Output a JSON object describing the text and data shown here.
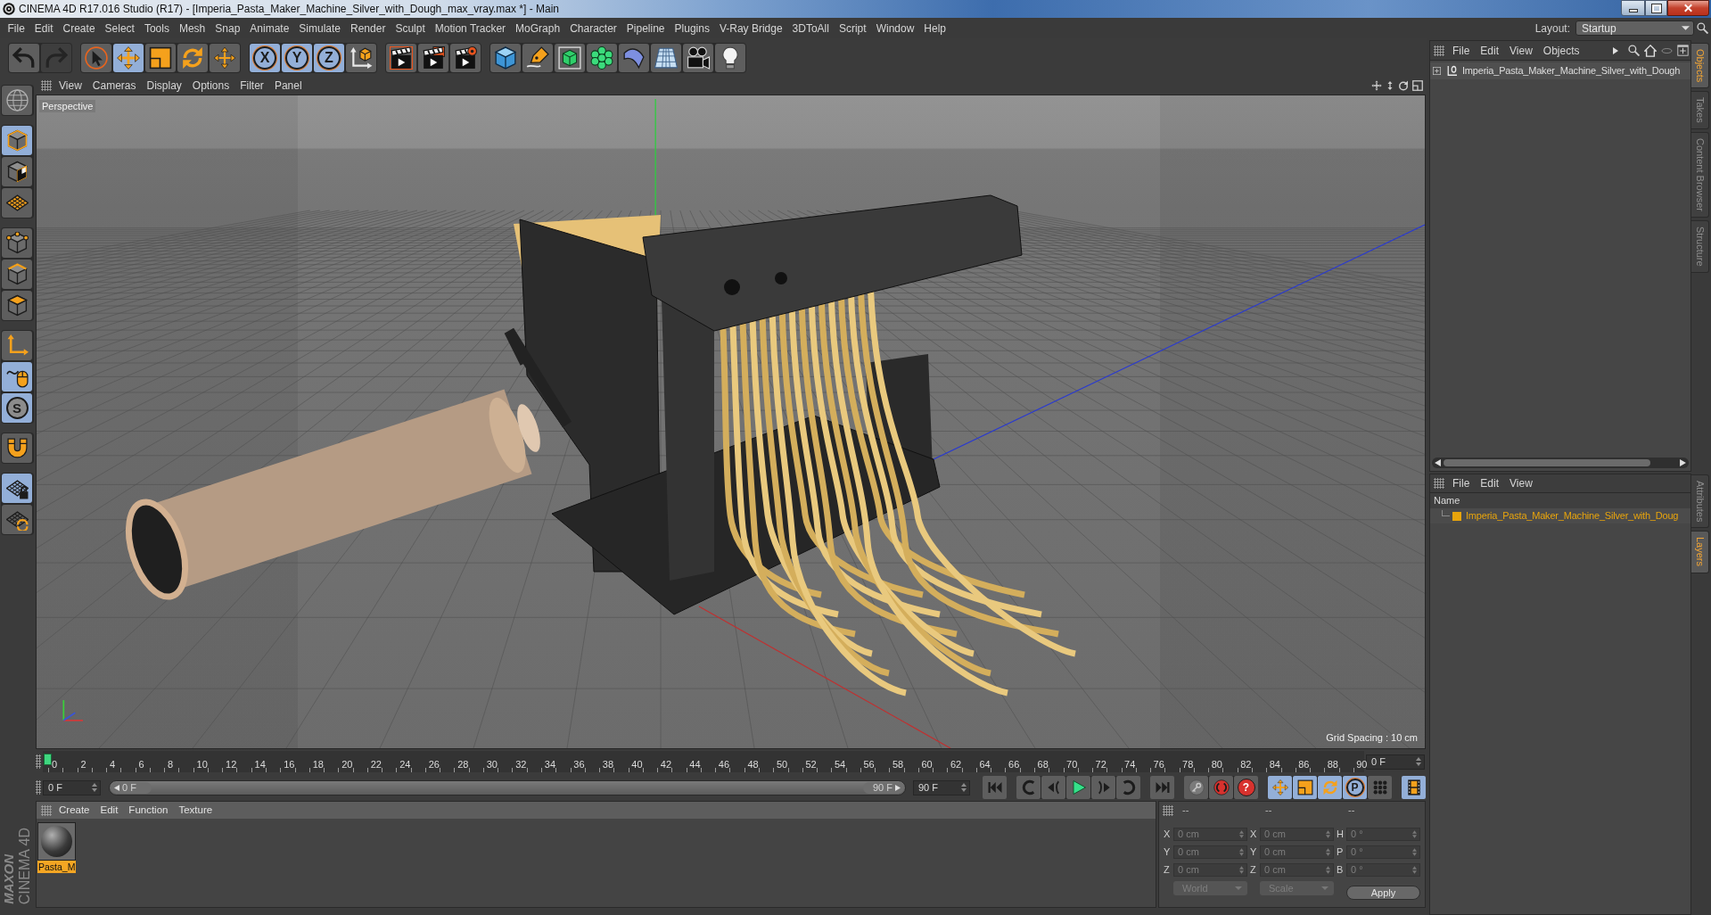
{
  "window": {
    "title": "CINEMA 4D R17.016 Studio (R17) - [Imperia_Pasta_Maker_Machine_Silver_with_Dough_max_vray.max *] - Main",
    "controls": [
      {
        "kind": "minimize"
      },
      {
        "kind": "maximize"
      },
      {
        "kind": "close"
      }
    ]
  },
  "menu_bar": [
    "File",
    "Edit",
    "Create",
    "Select",
    "Tools",
    "Mesh",
    "Snap",
    "Animate",
    "Simulate",
    "Render",
    "Sculpt",
    "Motion Tracker",
    "MoGraph",
    "Character",
    "Pipeline",
    "Plugins",
    "V-Ray Bridge",
    "3DToAll",
    "Script",
    "Window",
    "Help"
  ],
  "layout": {
    "label": "Layout:",
    "value": "Startup"
  },
  "toolbar": [
    [
      {
        "kind": "undo",
        "active": false,
        "disabled": false
      },
      {
        "kind": "redo",
        "active": false,
        "disabled": true
      }
    ],
    [
      {
        "kind": "select",
        "active": false,
        "disabled": false
      },
      {
        "kind": "move",
        "active": true,
        "disabled": false
      },
      {
        "kind": "scale",
        "active": false,
        "disabled": false
      },
      {
        "kind": "rotate",
        "active": false,
        "disabled": false
      },
      {
        "kind": "transform",
        "active": false,
        "disabled": false
      }
    ],
    [
      {
        "kind": "x-axis",
        "label": "X",
        "active": true,
        "disabled": false
      },
      {
        "kind": "y-axis",
        "label": "Y",
        "active": true,
        "disabled": false
      },
      {
        "kind": "z-axis",
        "label": "Z",
        "active": true,
        "disabled": false
      },
      {
        "kind": "coordinate-system",
        "active": false,
        "disabled": false
      }
    ],
    [
      {
        "kind": "render-view",
        "active": false,
        "disabled": false
      },
      {
        "kind": "render-picture",
        "active": false,
        "disabled": false
      },
      {
        "kind": "render-settings",
        "active": false,
        "disabled": false
      }
    ],
    [
      {
        "kind": "cube",
        "active": false,
        "disabled": false
      },
      {
        "kind": "pen",
        "active": false,
        "disabled": false
      },
      {
        "kind": "subdivision",
        "active": false,
        "disabled": false
      },
      {
        "kind": "cloner",
        "active": false,
        "disabled": false
      },
      {
        "kind": "deformer",
        "active": false,
        "disabled": false
      },
      {
        "kind": "floor",
        "active": false,
        "disabled": false
      },
      {
        "kind": "camera",
        "active": false,
        "disabled": false
      },
      {
        "kind": "light",
        "active": false,
        "disabled": false
      }
    ]
  ],
  "left_tools": [
    [
      {
        "kind": "globe",
        "active": false
      }
    ],
    [
      {
        "kind": "model",
        "active": true
      },
      {
        "kind": "texture",
        "active": false
      },
      {
        "kind": "workplane",
        "active": false
      }
    ],
    [
      {
        "kind": "points",
        "active": false
      },
      {
        "kind": "edges",
        "active": false
      },
      {
        "kind": "polygons",
        "active": false
      }
    ],
    [
      {
        "kind": "axis",
        "active": false
      },
      {
        "kind": "tweak",
        "active": true
      },
      {
        "kind": "solo",
        "label": "S",
        "active": true
      }
    ],
    [
      {
        "kind": "snap",
        "active": false
      }
    ],
    [
      {
        "kind": "locked-workplane",
        "active": true
      },
      {
        "kind": "planar-workplane",
        "active": false
      }
    ]
  ],
  "viewport": {
    "menu": [
      "View",
      "Cameras",
      "Display",
      "Options",
      "Filter",
      "Panel"
    ],
    "camera": "Perspective",
    "grid_spacing": "Grid Spacing : 10 cm"
  },
  "timeline": {
    "labels": [
      "0",
      "2",
      "4",
      "6",
      "8",
      "10",
      "12",
      "14",
      "16",
      "18",
      "20",
      "22",
      "24",
      "26",
      "28",
      "30",
      "32",
      "34",
      "36",
      "38",
      "40",
      "42",
      "44",
      "46",
      "48",
      "50",
      "52",
      "54",
      "56",
      "58",
      "60",
      "62",
      "64",
      "66",
      "68",
      "70",
      "72",
      "74",
      "76",
      "78",
      "80",
      "82",
      "84",
      "86",
      "88",
      "90"
    ],
    "level": 0,
    "current_frame": "0 F",
    "start_frame": "0 F",
    "end_frame": "90 F"
  },
  "frame_range": {
    "handles": [
      {
        "label": "0 F",
        "level": 0
      },
      {
        "label": "90 F",
        "level": 1
      }
    ]
  },
  "playback_controls": [
    [
      {
        "kind": "first-frame",
        "active": false
      }
    ],
    [
      {
        "kind": "previous-key",
        "active": false
      },
      {
        "kind": "previous-frame",
        "active": false
      },
      {
        "kind": "play",
        "active": false
      },
      {
        "kind": "next-frame",
        "active": false
      },
      {
        "kind": "next-key",
        "active": false
      }
    ],
    [
      {
        "kind": "last-frame",
        "active": false
      }
    ],
    [
      {
        "kind": "key",
        "active": false
      },
      {
        "kind": "record",
        "active": false
      },
      {
        "kind": "question",
        "label": "?",
        "active": false
      }
    ],
    [
      {
        "kind": "move",
        "active": true
      },
      {
        "kind": "scale",
        "active": true
      },
      {
        "kind": "rotate",
        "active": true
      },
      {
        "kind": "parameter",
        "label": "P",
        "active": true
      },
      {
        "kind": "point-level",
        "active": false
      }
    ],
    [
      {
        "kind": "timeline",
        "active": true
      }
    ]
  ],
  "material_manager": {
    "menu": [
      "Create",
      "Edit",
      "Function",
      "Texture"
    ],
    "materials": [
      {
        "name": "Pasta_M",
        "selected": true
      }
    ]
  },
  "coordinates": {
    "headers": [
      "--",
      "--",
      "--"
    ],
    "rows": [
      {
        "position_axis": "X",
        "position": "0 cm",
        "size_axis": "X",
        "size": "0 cm",
        "rotation_axis": "H",
        "rotation": "0 °"
      },
      {
        "position_axis": "Y",
        "position": "0 cm",
        "size_axis": "Y",
        "size": "0 cm",
        "rotation_axis": "P",
        "rotation": "0 °"
      },
      {
        "position_axis": "Z",
        "position": "0 cm",
        "size_axis": "Z",
        "size": "0 cm",
        "rotation_axis": "B",
        "rotation": "0 °"
      }
    ],
    "mode": "World",
    "transform": "Scale",
    "apply": "Apply"
  },
  "object_manager": {
    "menu": [
      "File",
      "Edit",
      "View",
      "Objects"
    ],
    "objects": [
      {
        "name": "Imperia_Pasta_Maker_Machine_Silver_with_Dough",
        "expanded": false
      }
    ]
  },
  "layer_manager": {
    "menu": [
      "File",
      "Edit",
      "View"
    ],
    "column": "Name",
    "layers": [
      {
        "name": "Imperia_Pasta_Maker_Machine_Silver_with_Doug",
        "color": "#e8a40c"
      }
    ]
  },
  "side_tabs": [
    {
      "label": "Objects",
      "selected": true
    },
    {
      "label": "Takes",
      "selected": false
    },
    {
      "label": "Content Browser",
      "selected": false
    },
    {
      "label": "Structure",
      "selected": false
    }
  ],
  "side_tabs_lower": [
    {
      "label": "Attributes",
      "selected": false
    },
    {
      "label": "Layers",
      "selected": true
    }
  ],
  "logo": {
    "brand": "MAXON",
    "product": "CINEMA 4D"
  }
}
